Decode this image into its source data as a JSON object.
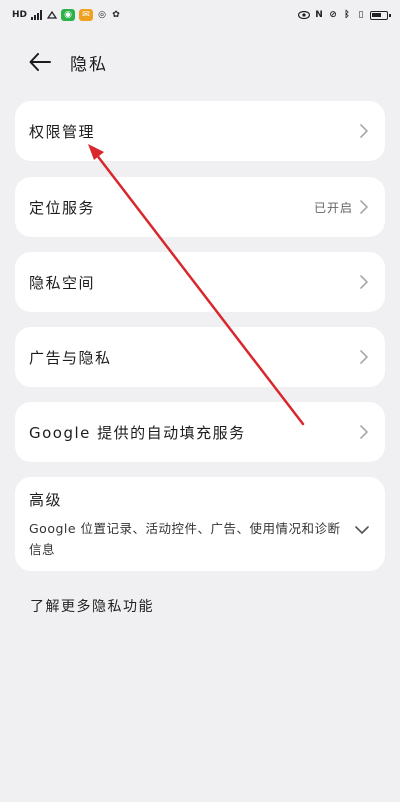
{
  "header": {
    "title": "隐私"
  },
  "rows": [
    {
      "label": "权限管理",
      "value": ""
    },
    {
      "label": "定位服务",
      "value": "已开启"
    },
    {
      "label": "隐私空间",
      "value": ""
    },
    {
      "label": "广告与隐私",
      "value": ""
    },
    {
      "label": "Google 提供的自动填充服务",
      "value": ""
    }
  ],
  "advanced": {
    "title": "高级",
    "description": "Google 位置记录、活动控件、广告、使用情况和诊断信息"
  },
  "footer": {
    "more_link": "了解更多隐私功能"
  },
  "annotation": {
    "arrow_color": "#d9272e"
  }
}
